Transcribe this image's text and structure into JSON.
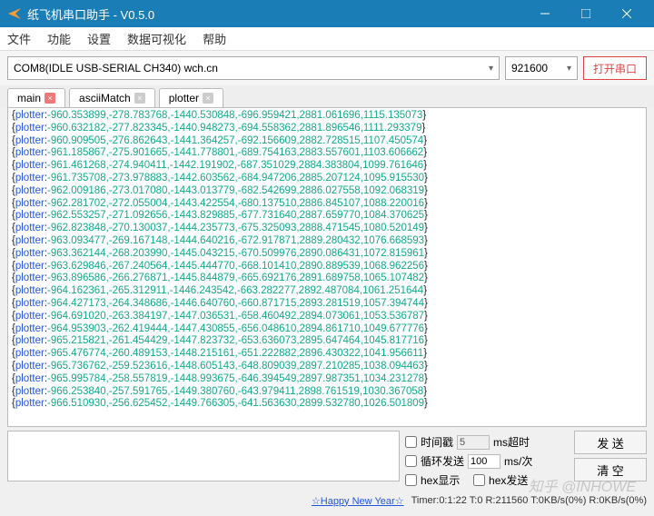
{
  "window": {
    "title": "纸飞机串口助手 - V0.5.0"
  },
  "menu": {
    "file": "文件",
    "func": "功能",
    "settings": "设置",
    "dataviz": "数据可视化",
    "help": "帮助"
  },
  "toolbar": {
    "port": "COM8(IDLE  USB-SERIAL CH340) wch.cn",
    "baud": "921600",
    "open": "打开串口"
  },
  "tabs": {
    "main": "main",
    "ascii": "asciiMatch",
    "plotter": "plotter"
  },
  "terminal_lines": [
    [
      "-960.353899",
      "-278.783768",
      "-1440.530848",
      "-696.959421",
      "2881.061696",
      "1115.135073"
    ],
    [
      "-960.632182",
      "-277.823345",
      "-1440.948273",
      "-694.558362",
      "2881.896546",
      "1111.293379"
    ],
    [
      "-960.909505",
      "-276.862643",
      "-1441.364257",
      "-692.156609",
      "2882.728515",
      "1107.450574"
    ],
    [
      "-961.185867",
      "-275.901665",
      "-1441.778801",
      "-689.754163",
      "2883.557601",
      "1103.606662"
    ],
    [
      "-961.461268",
      "-274.940411",
      "-1442.191902",
      "-687.351029",
      "2884.383804",
      "1099.761646"
    ],
    [
      "-961.735708",
      "-273.978883",
      "-1442.603562",
      "-684.947206",
      "2885.207124",
      "1095.915530"
    ],
    [
      "-962.009186",
      "-273.017080",
      "-1443.013779",
      "-682.542699",
      "2886.027558",
      "1092.068319"
    ],
    [
      "-962.281702",
      "-272.055004",
      "-1443.422554",
      "-680.137510",
      "2886.845107",
      "1088.220016"
    ],
    [
      "-962.553257",
      "-271.092656",
      "-1443.829885",
      "-677.731640",
      "2887.659770",
      "1084.370625"
    ],
    [
      "-962.823848",
      "-270.130037",
      "-1444.235773",
      "-675.325093",
      "2888.471545",
      "1080.520149"
    ],
    [
      "-963.093477",
      "-269.167148",
      "-1444.640216",
      "-672.917871",
      "2889.280432",
      "1076.668593"
    ],
    [
      "-963.362144",
      "-268.203990",
      "-1445.043215",
      "-670.509976",
      "2890.086431",
      "1072.815961"
    ],
    [
      "-963.629846",
      "-267.240564",
      "-1445.444770",
      "-668.101410",
      "2890.889539",
      "1068.962256"
    ],
    [
      "-963.896586",
      "-266.276871",
      "-1445.844879",
      "-665.692176",
      "2891.689758",
      "1065.107482"
    ],
    [
      "-964.162361",
      "-265.312911",
      "-1446.243542",
      "-663.282277",
      "2892.487084",
      "1061.251644"
    ],
    [
      "-964.427173",
      "-264.348686",
      "-1446.640760",
      "-660.871715",
      "2893.281519",
      "1057.394744"
    ],
    [
      "-964.691020",
      "-263.384197",
      "-1447.036531",
      "-658.460492",
      "2894.073061",
      "1053.536787"
    ],
    [
      "-964.953903",
      "-262.419444",
      "-1447.430855",
      "-656.048610",
      "2894.861710",
      "1049.677776"
    ],
    [
      "-965.215821",
      "-261.454429",
      "-1447.823732",
      "-653.636073",
      "2895.647464",
      "1045.817716"
    ],
    [
      "-965.476774",
      "-260.489153",
      "-1448.215161",
      "-651.222882",
      "2896.430322",
      "1041.956611"
    ],
    [
      "-965.736762",
      "-259.523616",
      "-1448.605143",
      "-648.809039",
      "2897.210285",
      "1038.094463"
    ],
    [
      "-965.995784",
      "-258.557819",
      "-1448.993675",
      "-646.394549",
      "2897.987351",
      "1034.231278"
    ],
    [
      "-966.253840",
      "-257.591765",
      "-1449.380760",
      "-643.979411",
      "2898.761519",
      "1030.367058"
    ],
    [
      "-966.510930",
      "-256.625452",
      "-1449.766305",
      "-641.563630",
      "2899.532780",
      "1026.501809"
    ]
  ],
  "bottom": {
    "timestamp": "时间戳",
    "timestamp_val": "5",
    "ms_timeout": "ms超时",
    "loop_send": "循环发送",
    "loop_val": "100",
    "ms_per": "ms/次",
    "hex_disp": "hex显示",
    "hex_send": "hex发送",
    "send_btn": "发 送",
    "clear_btn": "清 空"
  },
  "status": {
    "happy": "☆Happy New Year☆",
    "timer": "Timer:0:1:22 T:0 R:211560   T:0KB/s(0%) R:0KB/s(0%)"
  },
  "watermark": "知乎 @INHOWE"
}
